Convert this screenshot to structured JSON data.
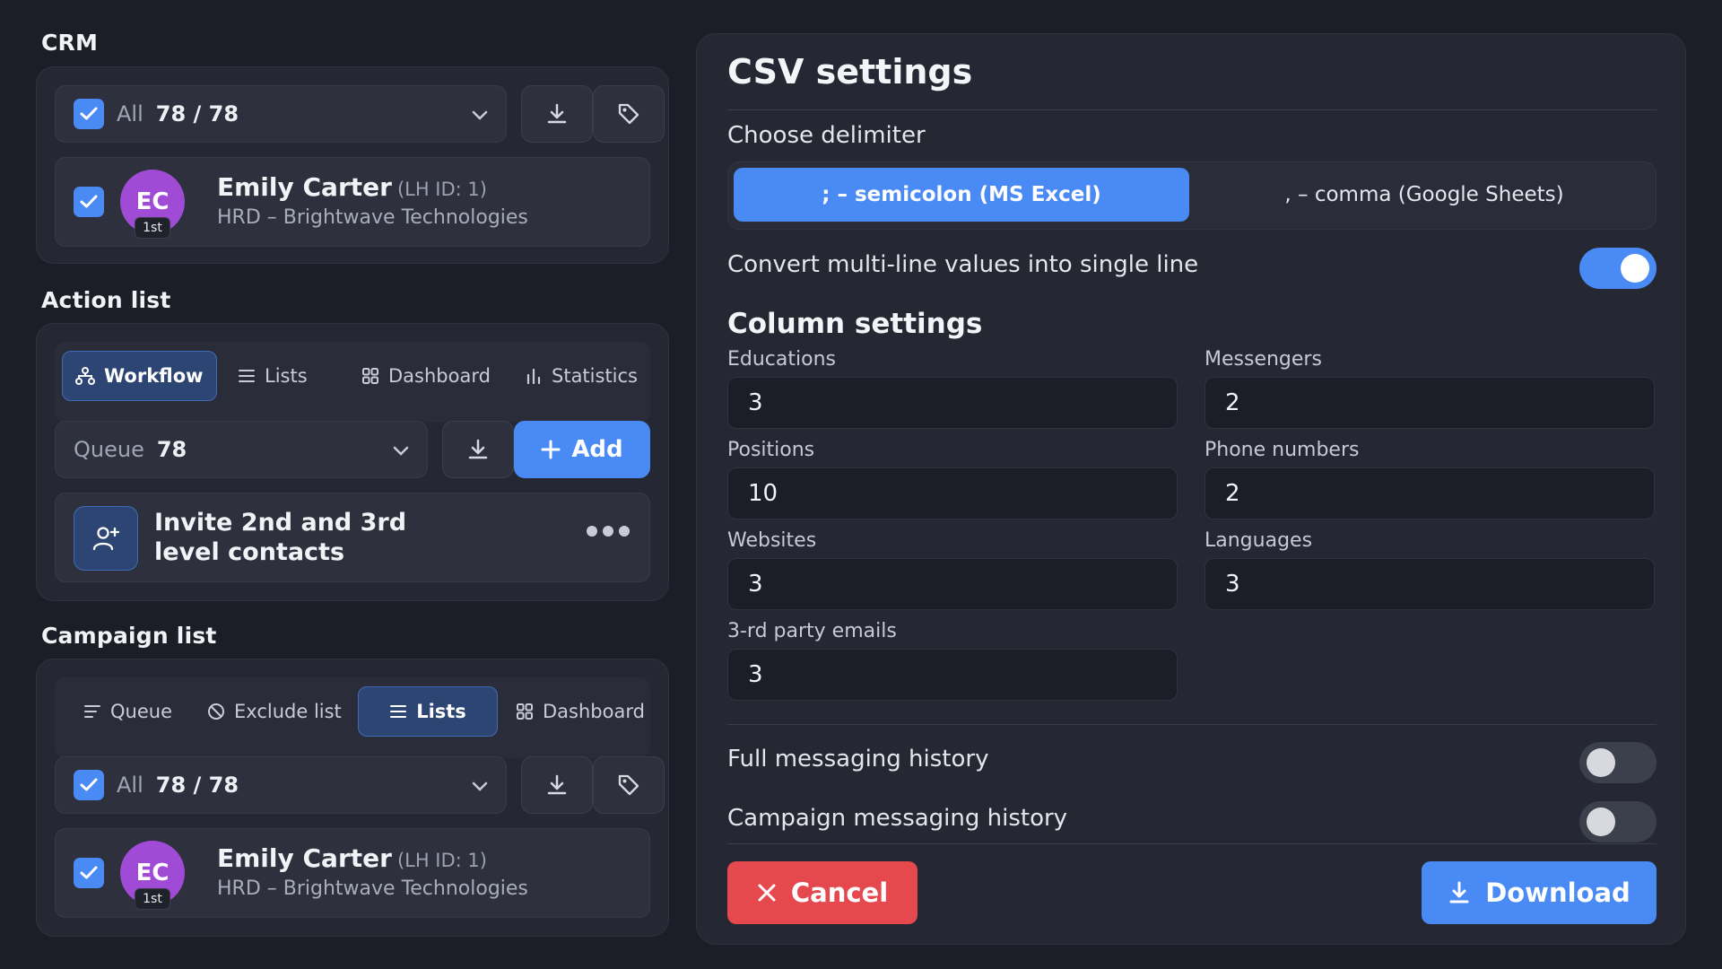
{
  "crm": {
    "title": "CRM",
    "select_label": "All",
    "select_count": "78 / 78",
    "contact": {
      "initials": "EC",
      "degree": "1st",
      "name": "Emily Carter",
      "id": "(LH ID: 1)",
      "subtitle": "HRD – Brightwave Technologies"
    }
  },
  "action_list": {
    "title": "Action list",
    "tabs": [
      {
        "label": "Workflow",
        "icon": "workflow-icon"
      },
      {
        "label": "Lists",
        "icon": "list-icon"
      },
      {
        "label": "Dashboard",
        "icon": "grid-icon"
      },
      {
        "label": "Statistics",
        "icon": "bar-chart-icon"
      }
    ],
    "queue_label": "Queue",
    "queue_count": "78",
    "add_label": "Add",
    "action_item": {
      "line1": "Invite 2nd and 3rd",
      "line2": "level contacts"
    }
  },
  "campaign_list": {
    "title": "Campaign list",
    "tabs": [
      {
        "label": "Queue",
        "icon": "queue-icon"
      },
      {
        "label": "Exclude list",
        "icon": "block-icon"
      },
      {
        "label": "Lists",
        "icon": "list-icon"
      },
      {
        "label": "Dashboard",
        "icon": "grid-icon"
      }
    ],
    "select_label": "All",
    "select_count": "78 / 78",
    "contact": {
      "initials": "EC",
      "degree": "1st",
      "name": "Emily Carter",
      "id": "(LH ID: 1)",
      "subtitle": "HRD – Brightwave Technologies"
    }
  },
  "csv": {
    "title": "CSV settings",
    "delimiter_label": "Choose delimiter",
    "delimiter_options": [
      "; – semicolon (MS Excel)",
      ", – comma (Google Sheets)"
    ],
    "convert_label": "Convert multi-line values into single line",
    "convert_on": true,
    "column_title": "Column settings",
    "fields": {
      "educations": {
        "label": "Educations",
        "value": "3"
      },
      "messengers": {
        "label": "Messengers",
        "value": "2"
      },
      "positions": {
        "label": "Positions",
        "value": "10"
      },
      "phones": {
        "label": "Phone numbers",
        "value": "2"
      },
      "websites": {
        "label": "Websites",
        "value": "3"
      },
      "languages": {
        "label": "Languages",
        "value": "3"
      },
      "emails": {
        "label": "3-rd party emails",
        "value": "3"
      }
    },
    "full_history_label": "Full messaging history",
    "full_history_on": false,
    "campaign_history_label": "Campaign messaging history",
    "campaign_history_on": false,
    "cancel_label": "Cancel",
    "download_label": "Download"
  },
  "colors": {
    "accent": "#4a8af4",
    "danger": "#e5484d",
    "avatar": "#a04bd6"
  }
}
